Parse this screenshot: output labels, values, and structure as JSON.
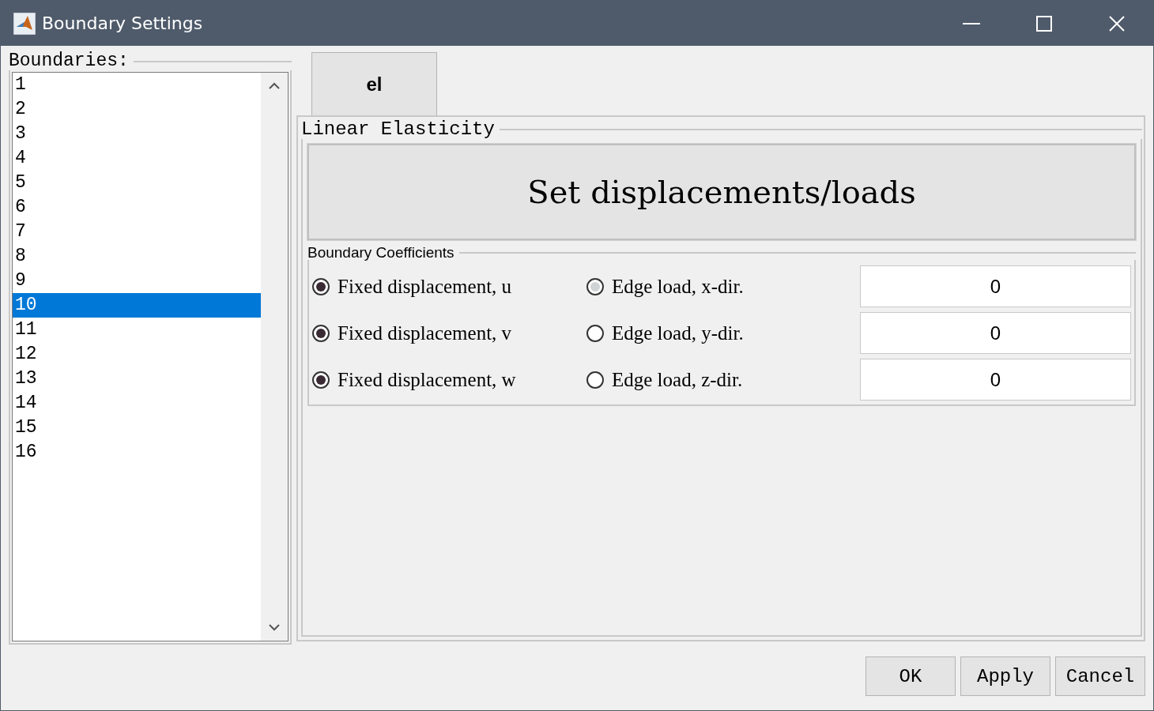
{
  "window": {
    "title": "Boundary Settings"
  },
  "boundaries": {
    "label": "Boundaries:",
    "items": [
      {
        "label": "1",
        "selected": false
      },
      {
        "label": "2",
        "selected": false
      },
      {
        "label": "3",
        "selected": false
      },
      {
        "label": "4",
        "selected": false
      },
      {
        "label": "5",
        "selected": false
      },
      {
        "label": "6",
        "selected": false
      },
      {
        "label": "7",
        "selected": false
      },
      {
        "label": "8",
        "selected": false
      },
      {
        "label": "9",
        "selected": false
      },
      {
        "label": "10",
        "selected": true
      },
      {
        "label": "11",
        "selected": false
      },
      {
        "label": "12",
        "selected": false
      },
      {
        "label": "13",
        "selected": false
      },
      {
        "label": "14",
        "selected": false
      },
      {
        "label": "15",
        "selected": false
      },
      {
        "label": "16",
        "selected": false
      }
    ]
  },
  "tabs": [
    {
      "label": "el",
      "selected": true
    }
  ],
  "panel": {
    "title": "Linear Elasticity",
    "action": "Set displacements/loads",
    "coefficients": {
      "title": "Boundary Coefficients",
      "rows": [
        {
          "fixed": {
            "label": "Fixed displacement, u",
            "checked": true
          },
          "load": {
            "label": "Edge load, x-dir.",
            "checked": false,
            "highlighted": true
          },
          "value": "0"
        },
        {
          "fixed": {
            "label": "Fixed displacement, v",
            "checked": true
          },
          "load": {
            "label": "Edge load, y-dir.",
            "checked": false,
            "highlighted": false
          },
          "value": "0"
        },
        {
          "fixed": {
            "label": "Fixed displacement, w",
            "checked": true
          },
          "load": {
            "label": "Edge load, z-dir.",
            "checked": false,
            "highlighted": false
          },
          "value": "0"
        }
      ]
    }
  },
  "buttons": [
    "OK",
    "Apply",
    "Cancel"
  ]
}
